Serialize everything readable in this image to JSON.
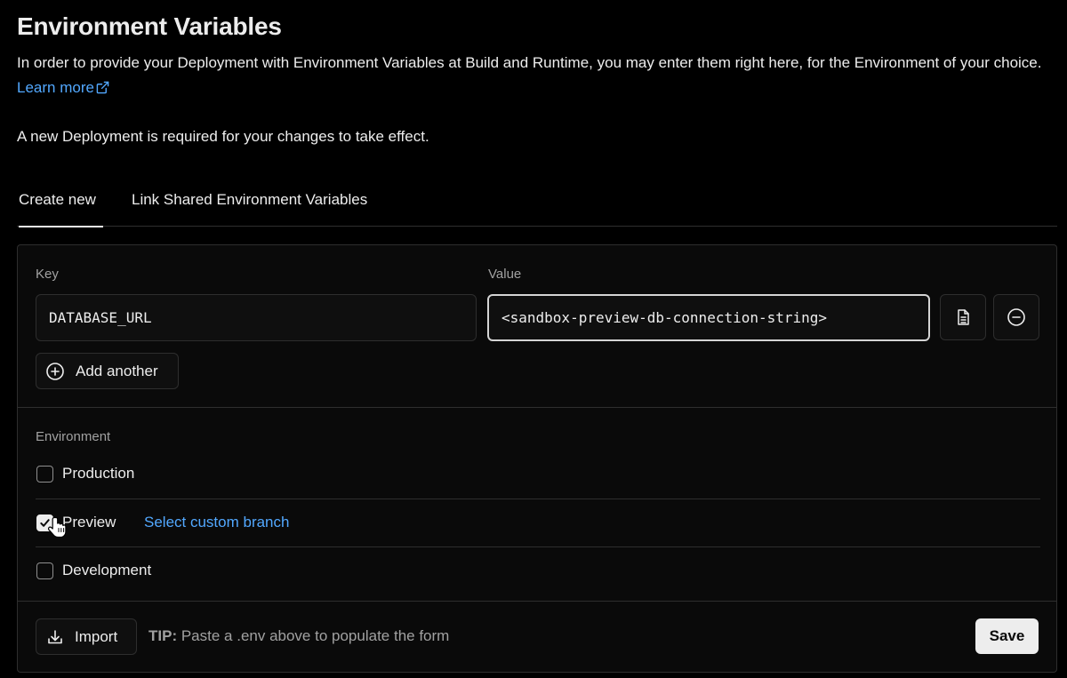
{
  "header": {
    "title": "Environment Variables",
    "description": "In order to provide your Deployment with Environment Variables at Build and Runtime, you may enter them right here, for the Environment of your choice.",
    "learn_more": "Learn more",
    "note": "A new Deployment is required for your changes to take effect."
  },
  "tabs": [
    {
      "label": "Create new",
      "active": true
    },
    {
      "label": "Link Shared Environment Variables",
      "active": false
    }
  ],
  "form": {
    "key_label": "Key",
    "value_label": "Value",
    "key_value": "DATABASE_URL",
    "value_value": "<sandbox-preview-db-connection-string>",
    "add_another": "Add another"
  },
  "environment": {
    "label": "Environment",
    "options": [
      {
        "name": "Production",
        "checked": false
      },
      {
        "name": "Preview",
        "checked": true,
        "link": "Select custom branch"
      },
      {
        "name": "Development",
        "checked": false
      }
    ]
  },
  "footer": {
    "import_label": "Import",
    "tip_prefix": "TIP:",
    "tip_text": "Paste a .env above to populate the form",
    "save_label": "Save"
  },
  "colors": {
    "background": "#000000",
    "card": "#0a0a0a",
    "border": "#2e2e2e",
    "text": "#ededed",
    "muted": "#a1a1a1",
    "link": "#52a8ff"
  }
}
